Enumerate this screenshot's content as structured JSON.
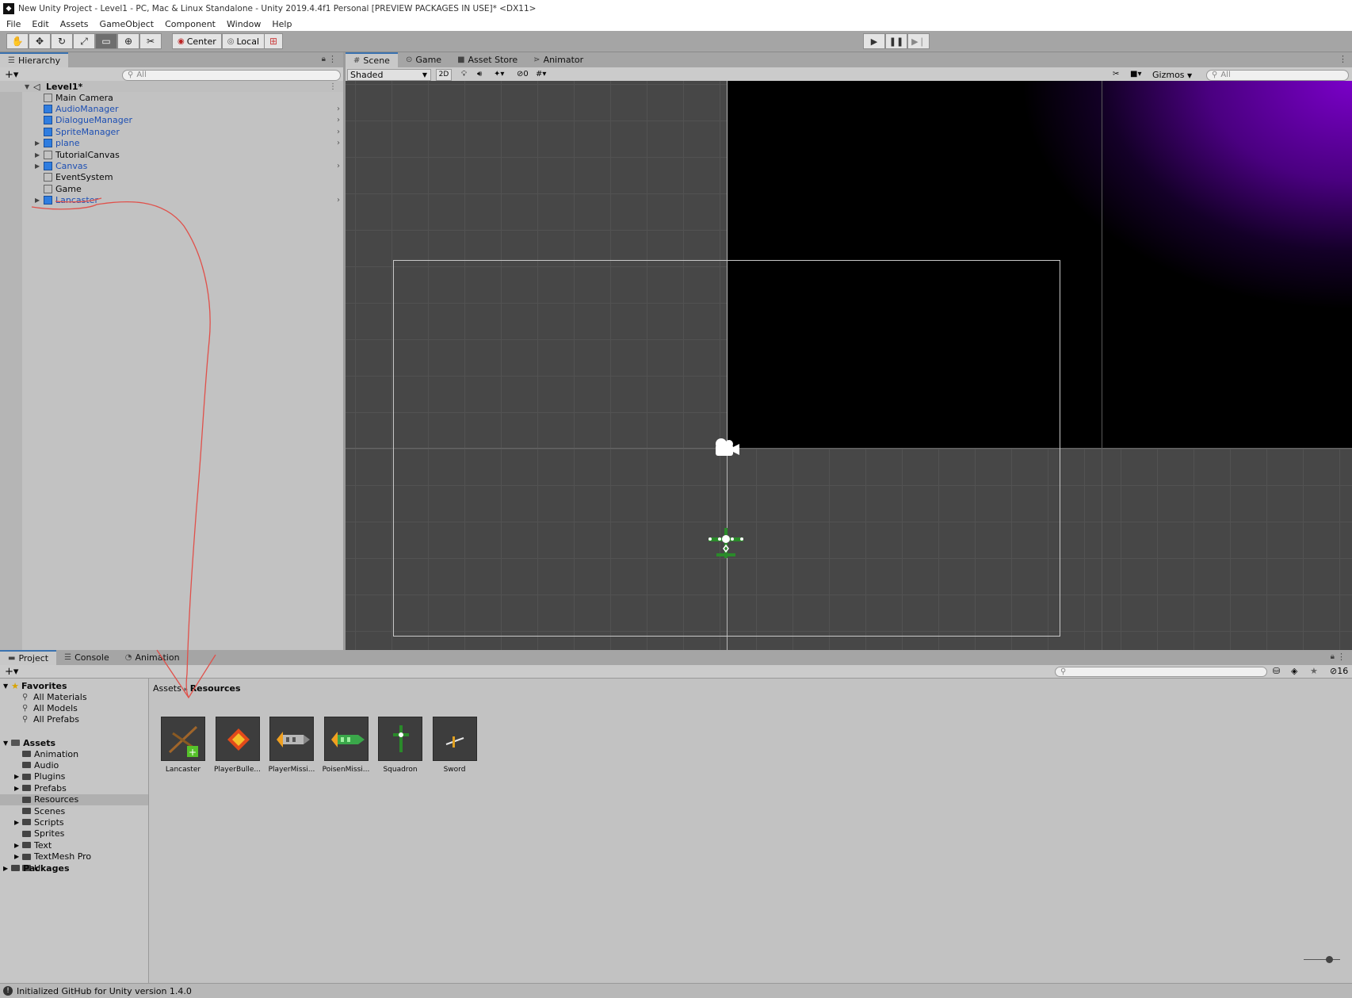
{
  "window": {
    "title": "New Unity Project - Level1 - PC, Mac & Linux Standalone - Unity 2019.4.4f1 Personal [PREVIEW PACKAGES IN USE]* <DX11>"
  },
  "menu": [
    "File",
    "Edit",
    "Assets",
    "GameObject",
    "Component",
    "Window",
    "Help"
  ],
  "toolbar": {
    "pivot_label": "Center",
    "space_label": "Local"
  },
  "hierarchy": {
    "tab": "Hierarchy",
    "search_placeholder": "All",
    "scene_name": "Level1*",
    "items": [
      {
        "label": "Main Camera",
        "prefab": false,
        "expandable": false,
        "chevron": false
      },
      {
        "label": "AudioManager",
        "prefab": true,
        "expandable": false,
        "chevron": true
      },
      {
        "label": "DialogueManager",
        "prefab": true,
        "expandable": false,
        "chevron": true
      },
      {
        "label": "SpriteManager",
        "prefab": true,
        "expandable": false,
        "chevron": true
      },
      {
        "label": "plane",
        "prefab": true,
        "expandable": true,
        "chevron": true
      },
      {
        "label": "TutorialCanvas",
        "prefab": false,
        "expandable": true,
        "chevron": false
      },
      {
        "label": "Canvas",
        "prefab": true,
        "expandable": true,
        "chevron": true
      },
      {
        "label": "EventSystem",
        "prefab": false,
        "expandable": false,
        "chevron": false
      },
      {
        "label": "Game",
        "prefab": false,
        "expandable": false,
        "chevron": false
      },
      {
        "label": "Lancaster",
        "prefab": true,
        "expandable": true,
        "chevron": true
      }
    ]
  },
  "scene": {
    "tabs": [
      "Scene",
      "Game",
      "Asset Store",
      "Animator"
    ],
    "shading_mode": "Shaded",
    "mode_2d": "2D",
    "hidden_count": "0",
    "gizmos_label": "Gizmos",
    "search_placeholder": "All"
  },
  "project": {
    "tabs": [
      "Project",
      "Console",
      "Animation"
    ],
    "hidden_count": "16",
    "favorites_label": "Favorites",
    "favorites": [
      "All Materials",
      "All Models",
      "All Prefabs"
    ],
    "assets_label": "Assets",
    "folders": [
      {
        "label": "Animation",
        "expandable": false
      },
      {
        "label": "Audio",
        "expandable": false
      },
      {
        "label": "Plugins",
        "expandable": true
      },
      {
        "label": "Prefabs",
        "expandable": true
      },
      {
        "label": "Resources",
        "expandable": false
      },
      {
        "label": "Scenes",
        "expandable": false
      },
      {
        "label": "Scripts",
        "expandable": true
      },
      {
        "label": "Sprites",
        "expandable": false
      },
      {
        "label": "Text",
        "expandable": true
      },
      {
        "label": "TextMesh Pro",
        "expandable": true
      },
      {
        "label": "UI",
        "expandable": false
      }
    ],
    "packages_label": "Packages",
    "breadcrumb": {
      "root": "Assets",
      "current": "Resources"
    },
    "assets": [
      {
        "label": "Lancaster",
        "icon": "lancaster-plane-icon"
      },
      {
        "label": "PlayerBulle...",
        "icon": "orange-diamond-bullet-icon"
      },
      {
        "label": "PlayerMissi...",
        "icon": "grey-missile-icon"
      },
      {
        "label": "PoisenMissi...",
        "icon": "green-missile-icon"
      },
      {
        "label": "Squadron",
        "icon": "squadron-plane-icon"
      },
      {
        "label": "Sword",
        "icon": "sword-icon"
      }
    ]
  },
  "status": {
    "message": "Initialized GitHub for Unity version 1.4.0"
  },
  "colors": {
    "prefab_text": "#1d4fb3",
    "annotation": "#e0504a",
    "scene_bg": "#474747",
    "camera_purple": "#7a00c8"
  }
}
